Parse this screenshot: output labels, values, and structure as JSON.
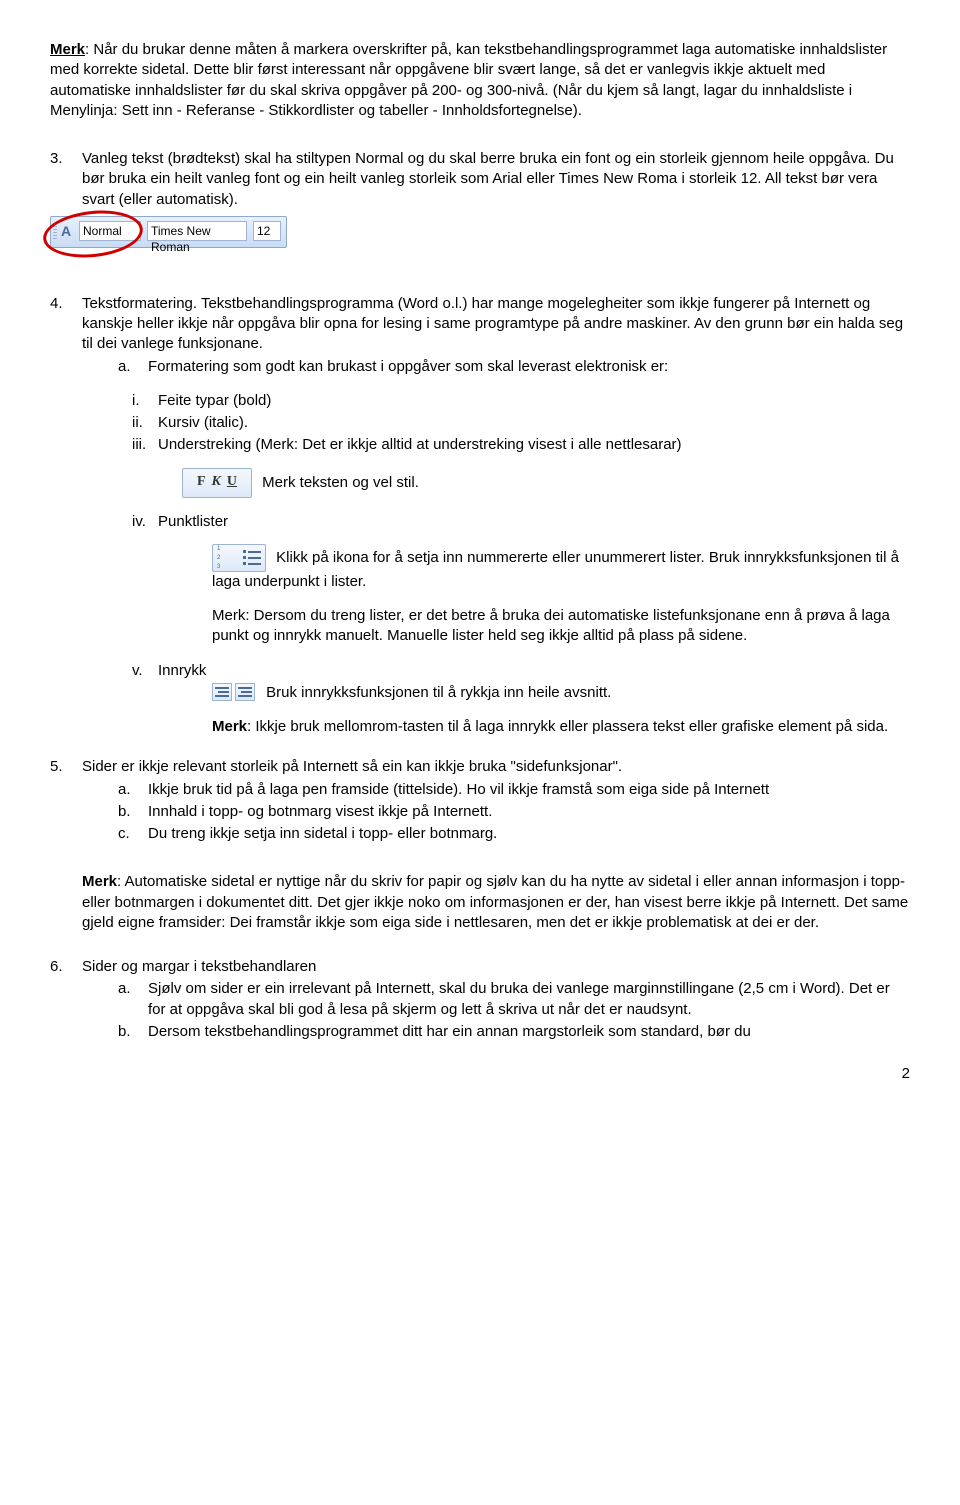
{
  "intro": {
    "merk_label": "Merk",
    "p1": ": Når du brukar denne måten å markera overskrifter på, kan tekstbehandlingsprogrammet laga automatiske innhaldslister med korrekte sidetal. Dette blir først interessant når oppgåvene blir svært lange, så det er vanlegvis ikkje aktuelt med automatiske innhaldslister før du skal skriva oppgåver på 200- og 300-nivå. (Når du kjem så langt, lagar du innhaldsliste i Menylinja: Sett inn - Referanse - Stikkordlister og tabeller - Innholdsfortegnelse)."
  },
  "item3": {
    "num": "3.",
    "text": "Vanleg tekst (brødtekst) skal ha stiltypen Normal og du skal berre bruka ein font og ein storleik gjennom heile oppgåva. Du bør bruka ein heilt vanleg font og ein heilt vanleg storleik som Arial eller Times New Roma i storleik 12. All tekst bør vera svart (eller automatisk)."
  },
  "toolbar": {
    "style": "Normal",
    "font": "Times New Roman",
    "size": "12"
  },
  "item4": {
    "num": "4.",
    "text": "Tekstformatering. Tekstbehandlingsprogramma (Word o.l.) har mange mogelegheiter som ikkje fungerer på Internett og kanskje heller ikkje når oppgåva blir opna for lesing i same programtype på andre maskiner. Av den grunn bør ein halda seg til dei vanlege funksjonane.",
    "a_marker": "a.",
    "a_text": "Formatering som godt kan brukast i oppgåver som skal leverast elektronisk er:",
    "i_marker": "i.",
    "i_text": "Feite typar (bold)",
    "ii_marker": "ii.",
    "ii_text": "Kursiv (italic).",
    "iii_marker": "iii.",
    "iii_text": "Understreking (Merk: Det er ikkje alltid at understreking visest  i alle nettlesarar)",
    "fku_after": " Merk teksten og vel stil.",
    "iv_marker": "iv.",
    "iv_text": "Punktlister",
    "list_after": " Klikk på ikona for å setja inn nummererte eller unummerert lister. Bruk innrykksfunksjonen til å laga underpunkt i lister.",
    "list_note": "Merk: Dersom du treng lister, er det betre å bruka dei automatiske listefunksjonane enn å prøva å laga punkt og innrykk manuelt. Manuelle lister held seg ikkje alltid på plass på sidene.",
    "v_marker": "v.",
    "v_text": "Innrykk",
    "indent_after": " Bruk innrykksfunksjonen til å rykkja inn heile avsnitt.",
    "indent_note_bold": "Merk",
    "indent_note": ": Ikkje bruk mellomrom-tasten til å laga innrykk eller plassera tekst eller grafiske element på sida."
  },
  "item5": {
    "num": "5.",
    "text": "Sider er ikkje relevant storleik på Internett så ein kan ikkje bruka \"sidefunksjonar\".",
    "a_marker": "a.",
    "a_text": "Ikkje bruk tid på å laga pen framside (tittelside). Ho vil ikkje framstå som eiga side på Internett",
    "b_marker": "b.",
    "b_text": "Innhald i topp- og botnmarg visest ikkje på Internett.",
    "c_marker": "c.",
    "c_text": "Du treng ikkje setja inn sidetal i topp- eller botnmarg."
  },
  "note5": {
    "bold": "Merk",
    "text": ": Automatiske sidetal er nyttige når du skriv for papir og sjølv kan du ha nytte av sidetal i eller annan informasjon i topp- eller botnmargen i dokumentet ditt. Det gjer ikkje noko om informasjonen er der, han visest berre ikkje på Internett. Det same gjeld eigne framsider: Dei framstår ikkje som eiga side i nettlesaren, men det er ikkje problematisk at dei er der."
  },
  "item6": {
    "num": "6.",
    "text": "Sider og margar i tekstbehandlaren",
    "a_marker": "a.",
    "a_text": "Sjølv om sider er ein irrelevant på Internett, skal du bruka dei vanlege marginnstillingane (2,5 cm i Word). Det er for at oppgåva skal bli god å lesa på skjerm og lett å skriva ut når det er naudsynt.",
    "b_marker": "b.",
    "b_text": "Dersom tekstbehandlingsprogrammet ditt har ein annan margstorleik som standard, bør du"
  },
  "F": "F",
  "K": "K",
  "U": "U",
  "page_number": "2"
}
